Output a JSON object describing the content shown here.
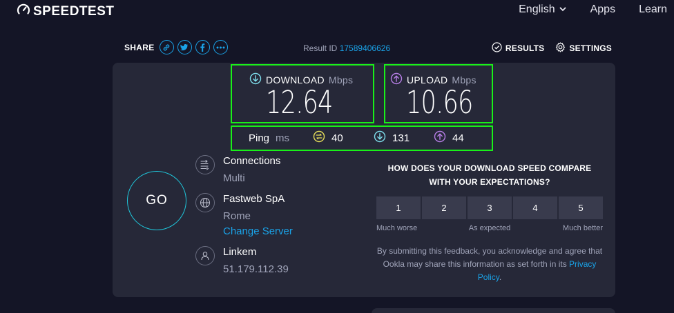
{
  "header": {
    "logo_text": "SPEEDTEST",
    "nav": [
      {
        "label": "English"
      },
      {
        "label": "Apps"
      },
      {
        "label": "Learn"
      }
    ]
  },
  "sharebar": {
    "share_label": "SHARE",
    "result_id_label": "Result ID",
    "result_id_value": "17589406626",
    "results_label": "RESULTS",
    "settings_label": "SETTINGS"
  },
  "download": {
    "label": "DOWNLOAD",
    "unit": "Mbps",
    "value": "12.64"
  },
  "upload": {
    "label": "UPLOAD",
    "unit": "Mbps",
    "value": "10.66"
  },
  "ping": {
    "label": "Ping",
    "unit": "ms",
    "idle": "40",
    "download": "131",
    "upload": "44"
  },
  "go_label": "GO",
  "info": {
    "connections_title": "Connections",
    "connections_value": "Multi",
    "host_title": "Fastweb SpA",
    "host_city": "Rome",
    "change_server": "Change Server",
    "isp_title": "Linkem",
    "isp_ip": "51.179.112.39"
  },
  "survey": {
    "question": "HOW DOES YOUR DOWNLOAD SPEED COMPARE WITH YOUR EXPECTATIONS?",
    "options": [
      "1",
      "2",
      "3",
      "4",
      "5"
    ],
    "label_low": "Much worse",
    "label_mid": "As expected",
    "label_high": "Much better",
    "disclaimer_text": "By submitting this feedback, you acknowledge and agree that Ookla may share this information as set forth in its",
    "privacy_link": "Privacy Policy",
    "disclaimer_end": "."
  },
  "colors": {
    "background": "#141526",
    "card": "#262838",
    "accent": "#1aa3e8",
    "highlight": "#19f019",
    "download_icon": "#7fe0ee",
    "upload_icon": "#b87fe8",
    "ping_icon": "#e8e05a"
  }
}
